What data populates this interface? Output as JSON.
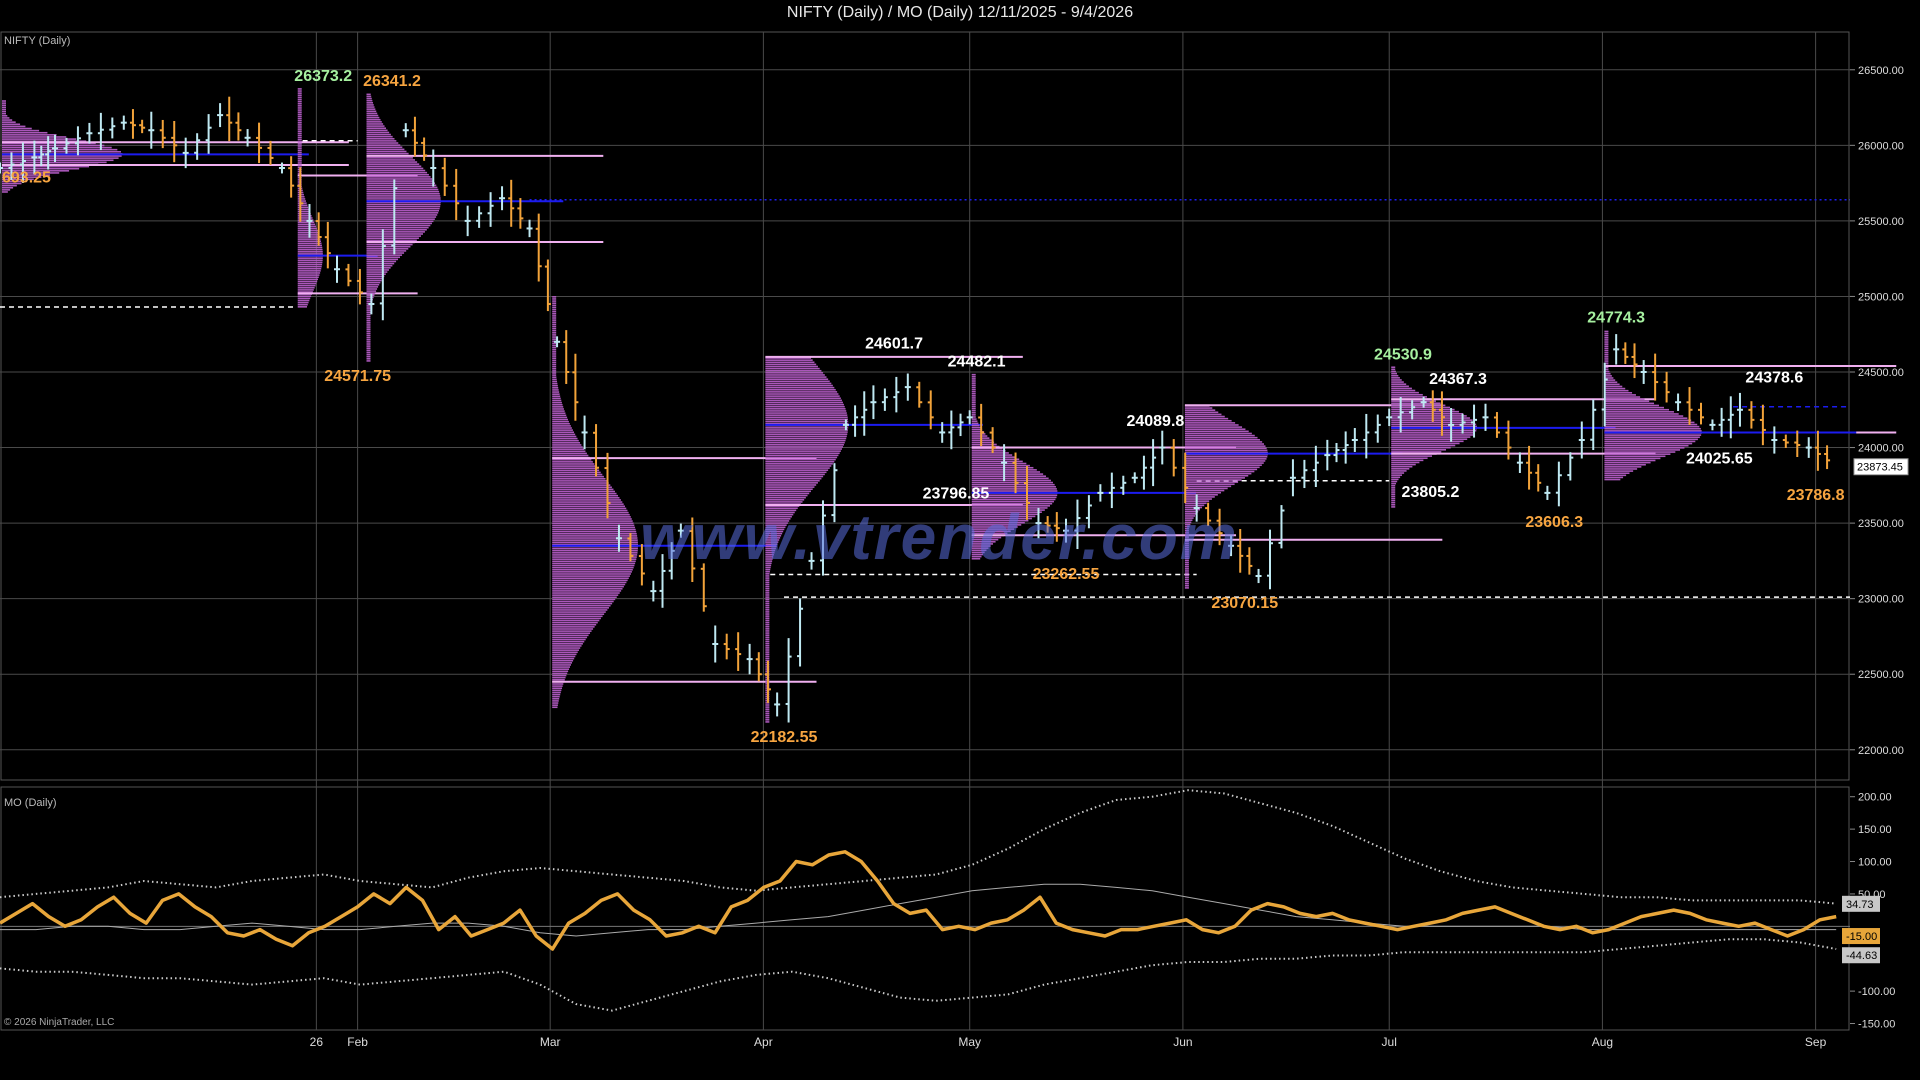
{
  "title": "NIFTY (Daily) / MO (Daily)  12/11/2025 - 9/4/2026",
  "price_panel_label": "NIFTY (Daily)",
  "mo_panel_label": "MO (Daily)",
  "copyright": "© 2026 NinjaTrader, LLC",
  "watermark": "www.vtrender.com",
  "current_price_label": "23873.45",
  "colors": {
    "background": "#000000",
    "up_bar": "#bfe9f2",
    "down_bar": "#f2a33a",
    "profile": "#b35cc4",
    "value_area_line": "#f0b0f0",
    "poc_line": "#1c1cf0",
    "mo_line": "#e8a63a",
    "mo_bands": "#cccccc",
    "label_orange": "#f7a540",
    "label_green": "#a6f0a0",
    "label_white": "#ffffff"
  },
  "chart_data": [
    {
      "type": "candlestick",
      "title": "NIFTY (Daily)",
      "x_ticks": [
        "26",
        "Feb",
        "Mar",
        "Apr",
        "May",
        "Jun",
        "Jul",
        "Aug",
        "Sep"
      ],
      "y_ticks": [
        "26500.00",
        "26000.00",
        "25500.00",
        "25000.00",
        "24500.00",
        "24000.00",
        "23500.00",
        "23000.00",
        "22500.00",
        "22000.00"
      ],
      "ylim": [
        21800,
        26750
      ],
      "annotations": [
        {
          "text": "693.25",
          "date": "2026-01-12",
          "price": 25700,
          "color": "orange"
        },
        {
          "text": "26373.2",
          "date": "2026-01-27",
          "price": 26373.2,
          "color": "green"
        },
        {
          "text": "26341.2",
          "date": "2026-02-06",
          "price": 26341.2,
          "color": "orange"
        },
        {
          "text": "24571.75",
          "date": "2026-02-01",
          "price": 24571.75,
          "color": "orange"
        },
        {
          "text": "24601.7",
          "date": "2026-04-20",
          "price": 24601.7,
          "color": "white"
        },
        {
          "text": "24482.1",
          "date": "2026-05-02",
          "price": 24482.1,
          "color": "white"
        },
        {
          "text": "23796.85",
          "date": "2026-04-29",
          "price": 23796.85,
          "color": "white"
        },
        {
          "text": "24089.8",
          "date": "2026-05-28",
          "price": 24089.8,
          "color": "white"
        },
        {
          "text": "23262.55",
          "date": "2026-05-15",
          "price": 23262.55,
          "color": "orange"
        },
        {
          "text": "22182.55",
          "date": "2026-04-04",
          "price": 22182.55,
          "color": "orange"
        },
        {
          "text": "23070.15",
          "date": "2026-06-10",
          "price": 23070.15,
          "color": "orange"
        },
        {
          "text": "24530.9",
          "date": "2026-07-03",
          "price": 24530.9,
          "color": "green"
        },
        {
          "text": "24367.3",
          "date": "2026-07-11",
          "price": 24367.3,
          "color": "white"
        },
        {
          "text": "23805.2",
          "date": "2026-07-07",
          "price": 23805.2,
          "color": "white"
        },
        {
          "text": "23606.3",
          "date": "2026-07-25",
          "price": 23606.3,
          "color": "orange"
        },
        {
          "text": "24774.3",
          "date": "2026-08-03",
          "price": 24774.3,
          "color": "green"
        },
        {
          "text": "24378.6",
          "date": "2026-08-26",
          "price": 24378.6,
          "color": "white"
        },
        {
          "text": "24025.65",
          "date": "2026-08-18",
          "price": 24025.65,
          "color": "white"
        },
        {
          "text": "23786.8",
          "date": "2026-09-01",
          "price": 23786.8,
          "color": "orange"
        }
      ],
      "segments": [
        {
          "start": "2025-12-11",
          "end": "2026-01-22",
          "low": 25690,
          "high": 26300,
          "poc": 25940,
          "vah": 26020,
          "val": 25870
        },
        {
          "start": "2026-01-23",
          "end": "2026-02-01",
          "low": 24930,
          "high": 26373,
          "poc": 25270,
          "vah": 25800,
          "val": 25020
        },
        {
          "start": "2026-02-02",
          "end": "2026-02-28",
          "low": 24572,
          "high": 26341,
          "poc": 25630,
          "vah": 25930,
          "val": 25360
        },
        {
          "start": "2026-03-01",
          "end": "2026-03-31",
          "low": 22280,
          "high": 25000,
          "poc": 23350,
          "vah": 23930,
          "val": 22450
        },
        {
          "start": "2026-04-01",
          "end": "2026-04-30",
          "low": 22183,
          "high": 24602,
          "poc": 24150,
          "vah": 24600,
          "val": 23620
        },
        {
          "start": "2026-05-01",
          "end": "2026-05-31",
          "low": 23263,
          "high": 24482,
          "poc": 23700,
          "vah": 24000,
          "val": 23420
        },
        {
          "start": "2026-06-01",
          "end": "2026-06-30",
          "low": 23070,
          "high": 24280,
          "poc": 23960,
          "vah": 24280,
          "val": 23390
        },
        {
          "start": "2026-07-01",
          "end": "2026-07-31",
          "low": 23606,
          "high": 24531,
          "poc": 24130,
          "vah": 24320,
          "val": 23960
        },
        {
          "start": "2026-08-01",
          "end": "2026-09-04",
          "low": 23787,
          "high": 24774,
          "poc": 24100,
          "vah": 24540,
          "val": 24100
        }
      ],
      "horizontal_levels": [
        {
          "price": 25640,
          "style": "dotted-blue"
        },
        {
          "price": 24930,
          "style": "dashed-white"
        },
        {
          "price": 26030,
          "style": "dashed-white"
        },
        {
          "price": 23160,
          "style": "dashed-white"
        },
        {
          "price": 23010,
          "style": "dashed-white"
        },
        {
          "price": 23780,
          "style": "dashed-white"
        },
        {
          "price": 24270,
          "style": "dashed-blue"
        }
      ],
      "close_series": {
        "dates": [
          "2025-12-11",
          "2025-12-16",
          "2025-12-19",
          "2025-12-24",
          "2025-12-29",
          "2026-01-02",
          "2026-01-07",
          "2026-01-12",
          "2026-01-16",
          "2026-01-21",
          "2026-01-25",
          "2026-01-29",
          "2026-02-03",
          "2026-02-08",
          "2026-02-12",
          "2026-02-17",
          "2026-02-22",
          "2026-02-26",
          "2026-03-02",
          "2026-03-06",
          "2026-03-11",
          "2026-03-16",
          "2026-03-20",
          "2026-03-25",
          "2026-03-30",
          "2026-04-03",
          "2026-04-08",
          "2026-04-13",
          "2026-04-17",
          "2026-04-22",
          "2026-04-27",
          "2026-05-01",
          "2026-05-06",
          "2026-05-11",
          "2026-05-15",
          "2026-05-20",
          "2026-05-25",
          "2026-05-29",
          "2026-06-03",
          "2026-06-08",
          "2026-06-12",
          "2026-06-17",
          "2026-06-22",
          "2026-06-26",
          "2026-07-01",
          "2026-07-06",
          "2026-07-10",
          "2026-07-15",
          "2026-07-20",
          "2026-07-24",
          "2026-07-29",
          "2026-08-03",
          "2026-08-07",
          "2026-08-12",
          "2026-08-17",
          "2026-08-21",
          "2026-08-26",
          "2026-08-31",
          "2026-09-04"
        ],
        "close": [
          25850,
          25920,
          25980,
          26080,
          26150,
          26100,
          25950,
          26200,
          26050,
          25850,
          25500,
          25180,
          24950,
          26100,
          25850,
          25500,
          25650,
          25450,
          24700,
          24100,
          23400,
          23050,
          23450,
          22700,
          22600,
          22300,
          23250,
          24150,
          24300,
          24400,
          24100,
          24200,
          23900,
          23500,
          23450,
          23700,
          23800,
          24000,
          23600,
          23350,
          23150,
          23800,
          23950,
          24050,
          24200,
          24300,
          24150,
          24200,
          23900,
          23700,
          24050,
          24650,
          24500,
          24300,
          24150,
          24250,
          24050,
          24000,
          23873
        ]
      }
    },
    {
      "type": "line",
      "title": "MO (Daily)",
      "y_ticks": [
        "200.00",
        "150.00",
        "100.00",
        "50.00",
        "-100.00",
        "-150.00"
      ],
      "ylim": [
        -160,
        215
      ],
      "value_labels": [
        "34.73",
        "-15.00",
        "-44.63"
      ],
      "series": [
        {
          "name": "MO",
          "values": [
            5,
            20,
            35,
            15,
            0,
            10,
            30,
            45,
            20,
            5,
            40,
            50,
            30,
            15,
            -10,
            -15,
            -5,
            -20,
            -30,
            -10,
            0,
            15,
            30,
            50,
            35,
            60,
            40,
            -5,
            15,
            -15,
            -5,
            5,
            25,
            -15,
            -35,
            5,
            20,
            40,
            50,
            25,
            10,
            -15,
            -10,
            0,
            -10,
            30,
            40,
            60,
            70,
            100,
            95,
            110,
            115,
            100,
            70,
            35,
            20,
            25,
            -5,
            0,
            -5,
            5,
            10,
            25,
            45,
            5,
            -5,
            -10,
            -15,
            -5,
            -5,
            0,
            5,
            10,
            -5,
            -10,
            0,
            25,
            35,
            30,
            20,
            15,
            20,
            10,
            5,
            0,
            -5,
            0,
            5,
            10,
            20,
            25,
            30,
            20,
            10,
            0,
            -5,
            0,
            -10,
            -5,
            5,
            15,
            20,
            25,
            20,
            10,
            5,
            0,
            5,
            -5,
            -15,
            -5,
            10,
            15
          ]
        },
        {
          "name": "Upper",
          "values": [
            45,
            50,
            55,
            60,
            70,
            65,
            60,
            70,
            75,
            80,
            70,
            65,
            60,
            75,
            85,
            90,
            85,
            80,
            75,
            70,
            60,
            55,
            60,
            65,
            70,
            75,
            80,
            95,
            120,
            150,
            175,
            195,
            200,
            210,
            205,
            190,
            175,
            155,
            130,
            105,
            85,
            70,
            60,
            55,
            50,
            45,
            45,
            40,
            40,
            40,
            40,
            35
          ]
        },
        {
          "name": "Lower",
          "values": [
            -65,
            -70,
            -70,
            -75,
            -80,
            -80,
            -85,
            -90,
            -85,
            -80,
            -90,
            -85,
            -80,
            -75,
            -70,
            -90,
            -120,
            -130,
            -115,
            -100,
            -85,
            -75,
            -70,
            -80,
            -95,
            -110,
            -115,
            -110,
            -105,
            -90,
            -80,
            -70,
            -60,
            -55,
            -55,
            -50,
            -50,
            -45,
            -45,
            -40,
            -40,
            -40,
            -40,
            -40,
            -40,
            -35,
            -30,
            -25,
            -20,
            -20,
            -25,
            -35
          ]
        },
        {
          "name": "Mid",
          "values": [
            -5,
            -5,
            0,
            0,
            -5,
            -5,
            0,
            5,
            0,
            -5,
            -5,
            0,
            5,
            5,
            0,
            -10,
            -15,
            -10,
            -5,
            -5,
            0,
            5,
            10,
            15,
            25,
            35,
            45,
            55,
            60,
            65,
            65,
            60,
            55,
            45,
            35,
            25,
            15,
            10,
            5,
            0,
            0,
            0,
            0,
            0,
            -5,
            -5,
            -5,
            -5,
            -5,
            -5,
            -5,
            -5
          ]
        }
      ]
    }
  ]
}
